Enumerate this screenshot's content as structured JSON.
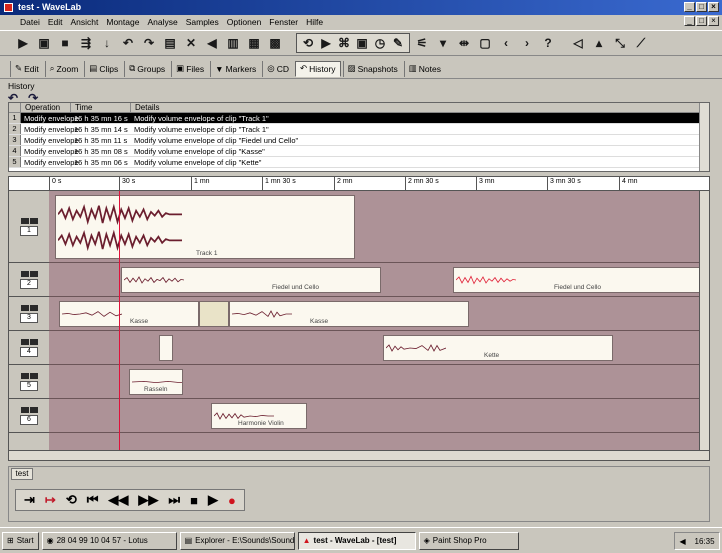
{
  "window": {
    "title": "test - WaveLab",
    "menus": [
      "Datei",
      "Edit",
      "Ansicht",
      "Montage",
      "Analyse",
      "Samples",
      "Optionen",
      "Fenster",
      "Hilfe"
    ]
  },
  "tabs": [
    {
      "label": "Edit",
      "icon": "edit-icon"
    },
    {
      "label": "Zoom",
      "icon": "zoom-icon"
    },
    {
      "label": "Clips",
      "icon": "clips-icon"
    },
    {
      "label": "Groups",
      "icon": "groups-icon"
    },
    {
      "label": "Files",
      "icon": "files-icon"
    },
    {
      "label": "Markers",
      "icon": "markers-icon"
    },
    {
      "label": "CD",
      "icon": "cd-icon"
    },
    {
      "label": "History",
      "icon": "history-icon",
      "active": true
    },
    {
      "label": "Snapshots",
      "icon": "snapshots-icon"
    },
    {
      "label": "Notes",
      "icon": "notes-icon"
    }
  ],
  "history": {
    "label": "History",
    "columns": [
      "Operation",
      "Time",
      "Details"
    ],
    "rows": [
      {
        "num": "1",
        "op": "Modify envelope",
        "time": "16 h 35 mn 16 s",
        "detail": "Modify volume envelope of clip \"Track 1\"",
        "selected": true
      },
      {
        "num": "2",
        "op": "Modify envelope",
        "time": "16 h 35 mn 14 s",
        "detail": "Modify volume envelope of clip \"Track 1\""
      },
      {
        "num": "3",
        "op": "Modify envelope",
        "time": "16 h 35 mn 11 s",
        "detail": "Modify volume envelope of clip \"Fiedel und Cello\""
      },
      {
        "num": "4",
        "op": "Modify envelope",
        "time": "16 h 35 mn 08 s",
        "detail": "Modify volume envelope of clip \"Kasse\""
      },
      {
        "num": "5",
        "op": "Modify envelope",
        "time": "16 h 35 mn 06 s",
        "detail": "Modify volume envelope of clip \"Kette\""
      }
    ]
  },
  "ruler": {
    "ticks": [
      "0 s",
      "30 s",
      "1 mn",
      "1 mn 30 s",
      "2 mn",
      "2 mn 30 s",
      "3 mn",
      "3 mn 30 s",
      "4 mn"
    ]
  },
  "tracks": [
    {
      "num": "1",
      "clips": [
        {
          "label": "Track 1"
        }
      ]
    },
    {
      "num": "2",
      "clips": [
        {
          "label": "Fiedel und Cello"
        },
        {
          "label": "Fiedel und Cello"
        }
      ]
    },
    {
      "num": "3",
      "clips": [
        {
          "label": "Kasse"
        },
        {
          "label": ""
        },
        {
          "label": "Kasse"
        }
      ]
    },
    {
      "num": "4",
      "clips": [
        {
          "label": ""
        },
        {
          "label": "Kette"
        }
      ]
    },
    {
      "num": "5",
      "clips": [
        {
          "label": "Rasseln"
        }
      ]
    },
    {
      "num": "6",
      "clips": [
        {
          "label": "Harmonie Violin"
        }
      ]
    }
  ],
  "transport": {
    "tab_label": "test"
  },
  "taskbar": {
    "start": "Start",
    "items": [
      {
        "label": "28 04 99 10 04 57 - Lotus"
      },
      {
        "label": "Explorer - E:\\Sounds\\Sound"
      },
      {
        "label": "test - WaveLab - [test]",
        "active": true
      },
      {
        "label": "Paint Shop Pro"
      }
    ],
    "clock": "16:35"
  }
}
